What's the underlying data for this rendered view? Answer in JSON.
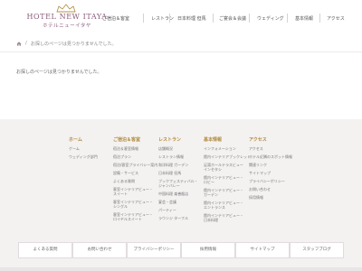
{
  "header": {
    "logo_en": "HOTEL NEW ITAYA",
    "logo_jp": "ホテルニューイタヤ",
    "nav": [
      "ご宿泊＆客室",
      "レストラン",
      "日本料理 但馬",
      "ご宴会＆会議",
      "ウェディング",
      "基本情報",
      "アクセス"
    ]
  },
  "breadcrumb": {
    "separator": "/",
    "current": "お探しのページは見つかりませんでした。"
  },
  "main": {
    "message": "お探しのページは見つかりませんでした。"
  },
  "footer": {
    "col1": {
      "title": "ホーム",
      "links": [
        "ゲーム",
        "ウェディング部門"
      ]
    },
    "col2": {
      "title": "ご宿泊＆客室",
      "links": [
        "宿泊＆客室情報",
        "宿泊プラン",
        "宿泊/客室プライバシー案内",
        "設備・サービス",
        "よくある質問",
        "客室インテリアビュー・スイート",
        "客室インテリアビュー・シングル",
        "客室インテリアビュー・ロイヤルスイート"
      ]
    },
    "col3": {
      "title": "レストラン",
      "links": [
        "店舗概況",
        "レストラン情報",
        "和洋料理 ガーデン",
        "日本料理 但馬",
        "ブックフェスティバル・ジャンバレー",
        "中国料理 楽善飯店",
        "宴会・会議",
        "パーティー",
        "ラウンジ ターフル"
      ]
    },
    "col4": {
      "title": "基本情報",
      "links": [
        "インフォメーション",
        "館内インテリアブックレット",
        "足湯ホールテラスビューインセタシ",
        "館内インテリアビュー・ロビー",
        "館内インテリアビュー・ガーデン",
        "館内インテリアビュー・エントランス",
        "館内インテリアビュー・日本料理"
      ]
    },
    "col5": {
      "title": "アクセス",
      "links": [
        "アクセス",
        "ホテル近隣のスポット情報",
        "関連リンク",
        "サイトマップ",
        "プライバシーポリシー",
        "お問い合わせ",
        "採用情報"
      ]
    },
    "buttons": [
      "よくある質問",
      "お問い合わせ",
      "プライバシーポリシー",
      "採用情報",
      "サイトマップ",
      "スタッフブログ"
    ]
  }
}
